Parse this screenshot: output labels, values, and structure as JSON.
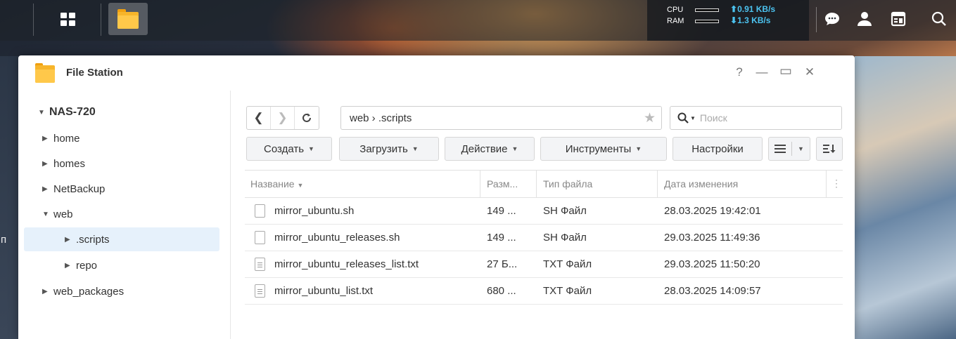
{
  "taskbar": {
    "main_menu_icon": "grid-icon",
    "file_station_icon": "folder-icon",
    "sysmon": {
      "cpu_label": "CPU",
      "ram_label": "RAM",
      "upload_rate": "0.91 KB/s",
      "download_rate": "1.3 KB/s"
    },
    "tray": [
      "chat-icon",
      "user-icon",
      "widgets-icon",
      "search-icon"
    ]
  },
  "desktop": {
    "left_glyph": "п"
  },
  "window": {
    "title": "File Station",
    "controls": {
      "help": "?",
      "minimize": "—",
      "maximize": "▭",
      "close": "✕"
    }
  },
  "sidebar": {
    "root": "NAS-720",
    "items": [
      {
        "label": "home",
        "expanded": false
      },
      {
        "label": "homes",
        "expanded": false
      },
      {
        "label": "NetBackup",
        "expanded": false
      },
      {
        "label": "web",
        "expanded": true
      },
      {
        "label": ".scripts",
        "expanded": false,
        "selected": true
      },
      {
        "label": "repo",
        "expanded": false
      },
      {
        "label": "web_packages",
        "expanded": false
      }
    ]
  },
  "toolbar": {
    "path": "web › .scripts",
    "search_placeholder": "Поиск",
    "create_label": "Создать",
    "upload_label": "Загрузить",
    "action_label": "Действие",
    "tools_label": "Инструменты",
    "settings_label": "Настройки"
  },
  "table": {
    "headers": [
      "Название",
      "Разм...",
      "Тип файла",
      "Дата изменения"
    ],
    "rows": [
      {
        "name": "mirror_ubuntu.sh",
        "size": "149 ...",
        "type": "SH Файл",
        "date": "28.03.2025 19:42:01",
        "icon": "file-icon"
      },
      {
        "name": "mirror_ubuntu_releases.sh",
        "size": "149 ...",
        "type": "SH Файл",
        "date": "29.03.2025 11:49:36",
        "icon": "file-icon"
      },
      {
        "name": "mirror_ubuntu_releases_list.txt",
        "size": "27 Б...",
        "type": "TXT Файл",
        "date": "29.03.2025 11:50:20",
        "icon": "text-file-icon"
      },
      {
        "name": "mirror_ubuntu_list.txt",
        "size": "680 ...",
        "type": "TXT Файл",
        "date": "28.03.2025 14:09:57",
        "icon": "text-file-icon"
      }
    ]
  },
  "colors": {
    "accent_rate": "#4cc3f0",
    "selection": "#e6f1fb",
    "folder": "#f7b52b"
  }
}
